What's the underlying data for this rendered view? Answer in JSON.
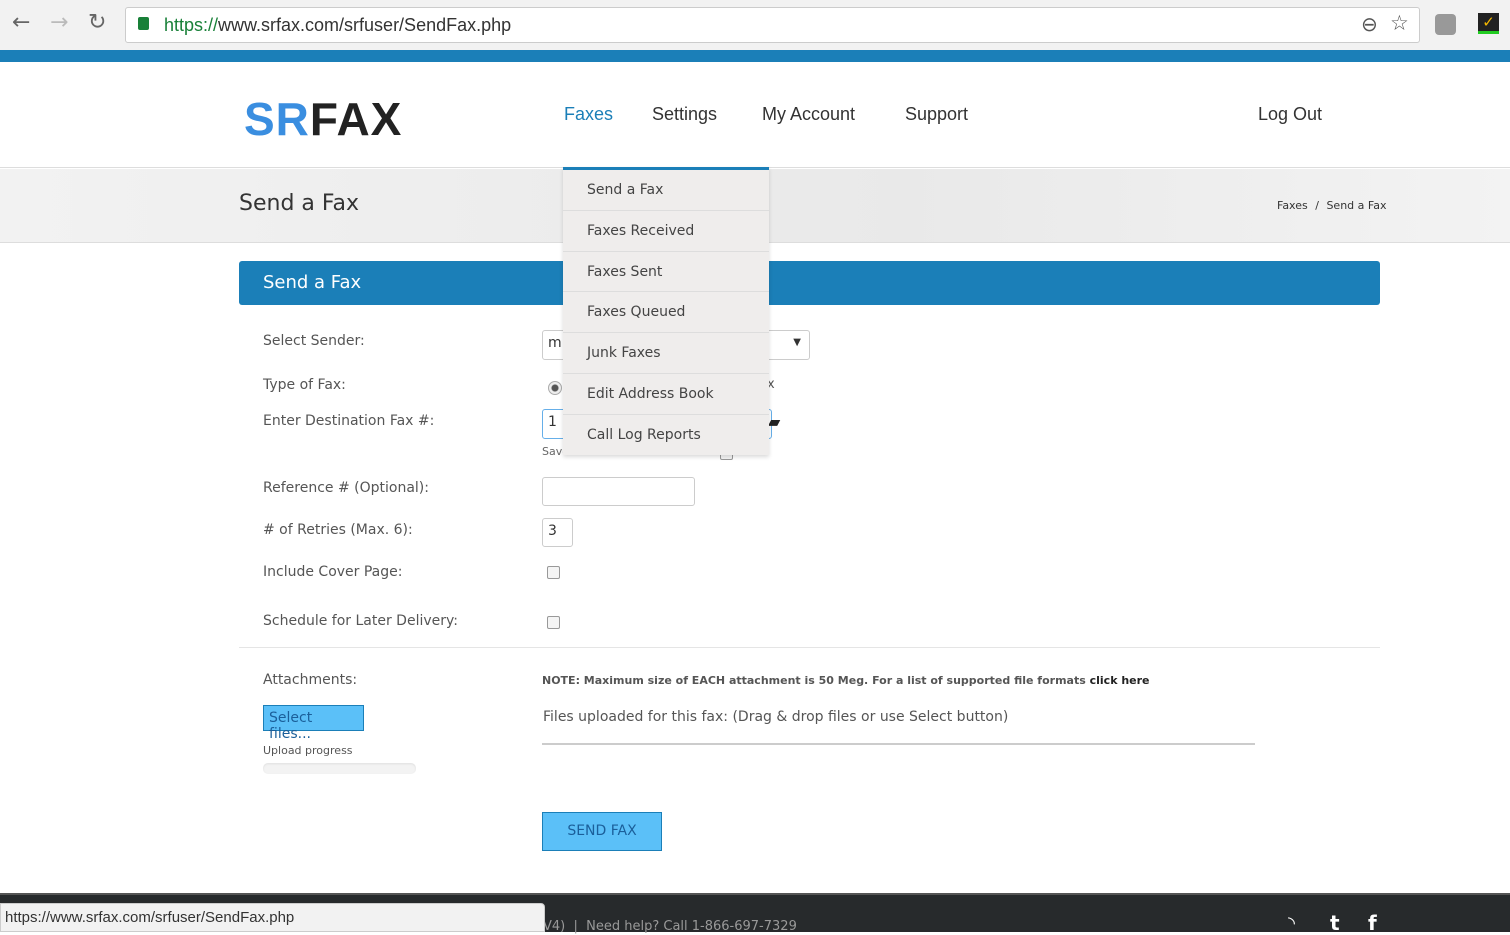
{
  "browser": {
    "url_scheme": "https://",
    "url_rest": "www.srfax.com/srfuser/SendFax.php",
    "status_url": "https://www.srfax.com/srfuser/SendFax.php"
  },
  "logo": {
    "text": "SRFAX"
  },
  "nav": {
    "items": [
      "Faxes",
      "Settings",
      "My Account",
      "Support"
    ],
    "logout": "Log Out",
    "active": "Faxes"
  },
  "page": {
    "title": "Send a Fax",
    "breadcrumb": [
      "Faxes",
      "Send a Fax"
    ],
    "breadcrumb_sep": "/"
  },
  "faxes_menu": [
    "Send a Fax",
    "Faxes Received",
    "Faxes Sent",
    "Faxes Queued",
    "Junk Faxes",
    "Edit Address Book",
    "Call Log Reports"
  ],
  "form": {
    "panel_title": "Send a Fax",
    "sender_label": "Select Sender:",
    "sender_value": "m",
    "type_label": "Type of Fax:",
    "type_suffix": "x",
    "dest_label": "Enter Destination Fax #:",
    "dest_value": "1",
    "save_label": "Save Number to Address Book",
    "ref_label": "Reference # (Optional):",
    "ref_value": "",
    "retries_label": "# of Retries (Max. 6):",
    "retries_value": "3",
    "cover_label": "Include Cover Page:",
    "schedule_label": "Schedule for Later Delivery:",
    "attach_label": "Attachments:",
    "select_files": "Select files...",
    "upload_progress": "Upload progress",
    "upload_progress_percent": 0,
    "note": "NOTE: Maximum size of EACH attachment is 50 Meg. For a list of supported file formats",
    "note_link": "click here",
    "files_text": "Files uploaded for this fax: (Drag & drop files or use Select button)",
    "send": "SEND FAX"
  },
  "footer": {
    "text": "V4)  |  Need help? Call 1-866-697-7329",
    "icons": [
      "rss-icon",
      "twitter-icon",
      "facebook-icon"
    ]
  },
  "colors": {
    "brand": "#1b7fb8",
    "footer": "#272a2c"
  }
}
